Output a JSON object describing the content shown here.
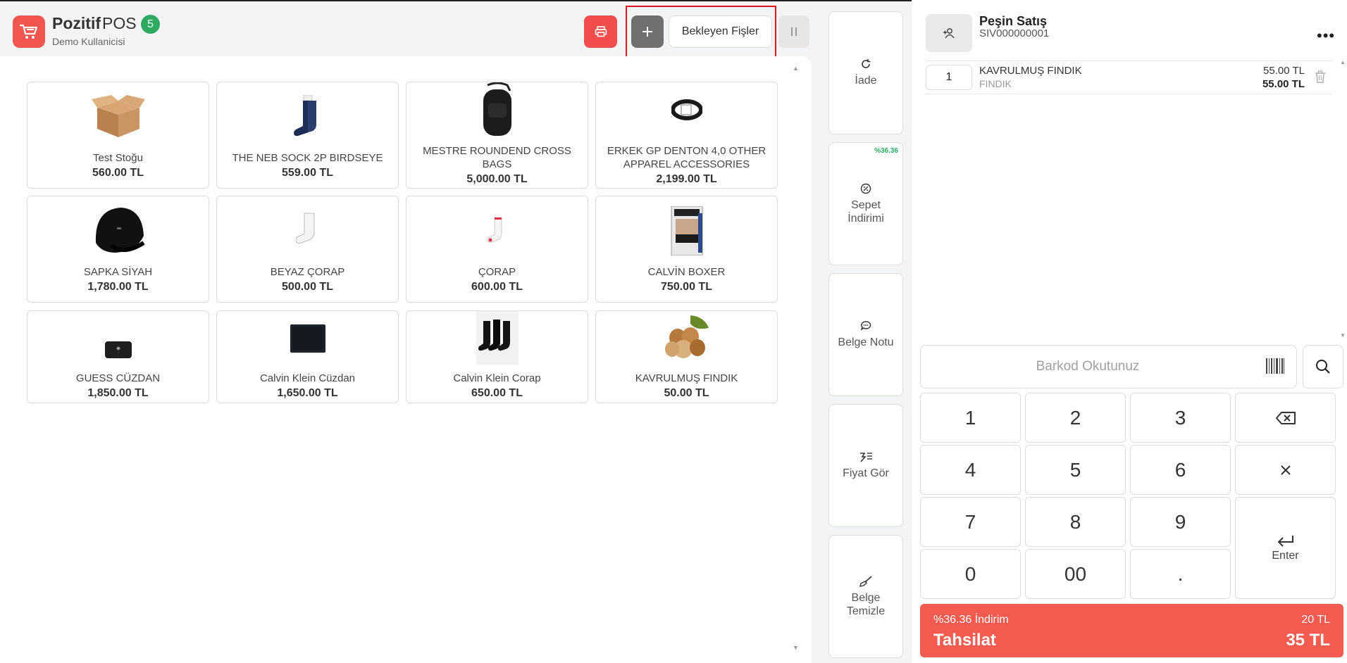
{
  "app": {
    "brand_bold": "Pozitif",
    "brand_light": "POS",
    "badge_count": "5",
    "user": "Demo Kullanicisi"
  },
  "toolbar": {
    "pending_label": "Bekleyen Fişler"
  },
  "products": [
    {
      "name": "Test Stoğu",
      "price": "560.00 TL",
      "icon": "box-image"
    },
    {
      "name": "THE NEB SOCK 2P BIRDSEYE",
      "price": "559.00 TL",
      "icon": "sock-image"
    },
    {
      "name": "MESTRE ROUNDEND CROSS BAGS",
      "price": "5,000.00 TL",
      "icon": "bag-image"
    },
    {
      "name": "ERKEK GP DENTON 4,0 OTHER APPAREL ACCESSORIES",
      "price": "2,199.00 TL",
      "icon": "belt-image"
    },
    {
      "name": "SAPKA SİYAH",
      "price": "1,780.00 TL",
      "icon": "cap-image"
    },
    {
      "name": "BEYAZ ÇORAP",
      "price": "500.00 TL",
      "icon": "white-sock-image"
    },
    {
      "name": "ÇORAP",
      "price": "600.00 TL",
      "icon": "sock-image"
    },
    {
      "name": "CALVİN BOXER",
      "price": "750.00 TL",
      "icon": "boxer-image"
    },
    {
      "name": "GUESS CÜZDAN",
      "price": "1,850.00 TL",
      "icon": "wallet-image"
    },
    {
      "name": "Calvin Klein Cüzdan",
      "price": "1,650.00 TL",
      "icon": "wallet-image"
    },
    {
      "name": "Calvin Klein Corap",
      "price": "650.00 TL",
      "icon": "socks-image"
    },
    {
      "name": "KAVRULMUŞ FINDIK",
      "price": "50.00 TL",
      "icon": "hazelnut-image"
    }
  ],
  "actions": {
    "iade": "İade",
    "discount_pct": "%36.36",
    "sepet_1": "Sepet",
    "sepet_2": "İndirimi",
    "note": "Belge Notu",
    "price_check": "Fiyat Gör",
    "clear_1": "Belge",
    "clear_2": "Temizle"
  },
  "customer": {
    "name": "Peşin Satış",
    "doc_no": "SIV000000001"
  },
  "cart": [
    {
      "qty": "1",
      "name": "KAVRULMUŞ FINDIK",
      "sub": "FINDIK",
      "unit_price": "55.00 TL",
      "total": "55.00 TL"
    }
  ],
  "barcode": {
    "placeholder": "Barkod Okutunuz"
  },
  "keypad": {
    "k1": "1",
    "k2": "2",
    "k3": "3",
    "k4": "4",
    "k5": "5",
    "k6": "6",
    "k7": "7",
    "k8": "8",
    "k9": "9",
    "k0": "0",
    "k00": "00",
    "kdot": ".",
    "enter": "Enter"
  },
  "payment": {
    "discount_label": "%36.36 İndirim",
    "discount_amount": "20 TL",
    "title": "Tahsilat",
    "total": "35 TL"
  },
  "colors": {
    "accent": "#f0564f",
    "badge": "#2eaa62",
    "highlight": "#e0141c"
  }
}
